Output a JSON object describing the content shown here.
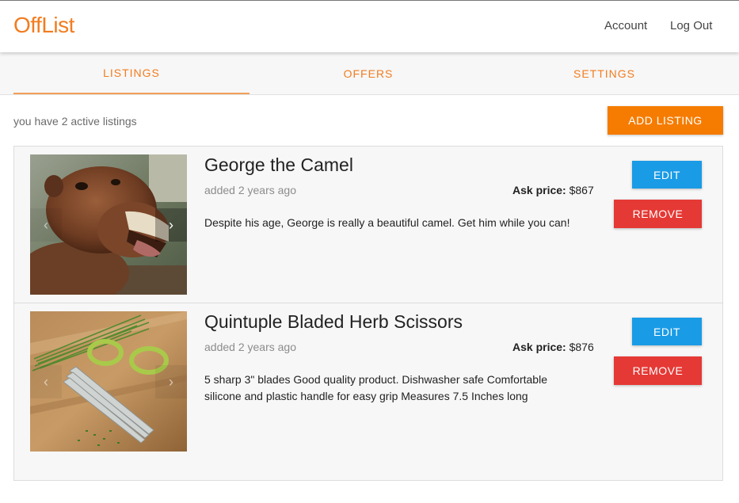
{
  "header": {
    "logo": "OffList",
    "nav": {
      "account": "Account",
      "logout": "Log Out"
    }
  },
  "tabs": [
    {
      "label": "LISTINGS",
      "active": true
    },
    {
      "label": "OFFERS",
      "active": false
    },
    {
      "label": "SETTINGS",
      "active": false
    }
  ],
  "summary": {
    "text": "you have 2 active listings"
  },
  "actions": {
    "add_listing": "ADD LISTING"
  },
  "colors": {
    "brand": "#f27c1f",
    "add_button": "#f57c00",
    "edit_button": "#1a9be6",
    "remove_button": "#e53935"
  },
  "listings": [
    {
      "title": "George the Camel",
      "added": "added 2 years ago",
      "ask_label": "Ask price:",
      "ask_value": "$867",
      "description": "Despite his age, George is really a beautiful camel. Get him while you can!",
      "edit_label": "EDIT",
      "remove_label": "REMOVE",
      "prev_icon": "‹",
      "next_icon": "›"
    },
    {
      "title": "Quintuple Bladed Herb Scissors",
      "added": "added 2 years ago",
      "ask_label": "Ask price:",
      "ask_value": "$876",
      "description": "5 sharp 3\" blades Good quality product. Dishwasher safe Comfortable silicone and plastic handle for easy grip Measures 7.5 Inches long",
      "edit_label": "EDIT",
      "remove_label": "REMOVE",
      "prev_icon": "‹",
      "next_icon": "›"
    }
  ]
}
